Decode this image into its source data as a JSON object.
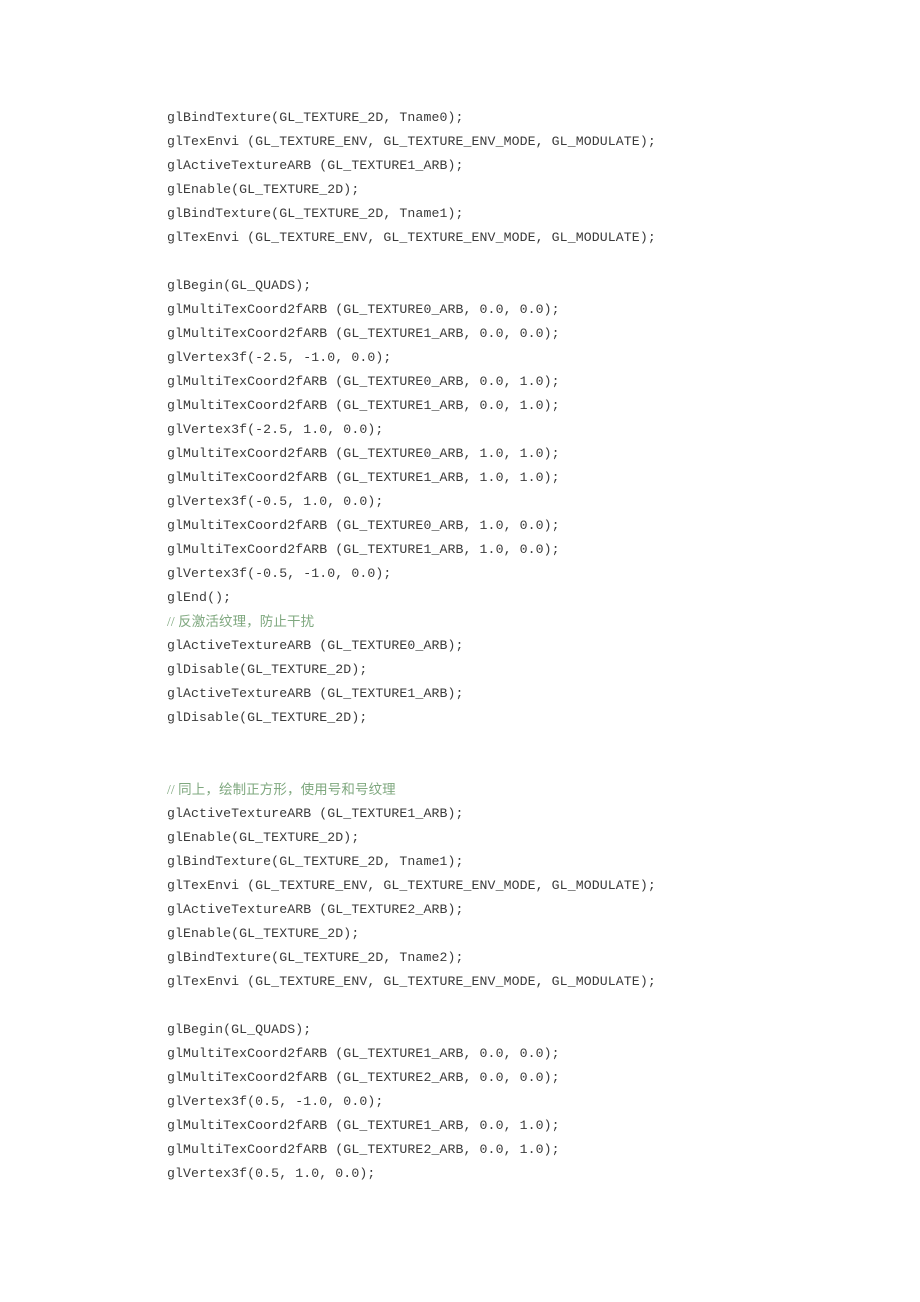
{
  "document": {
    "background_color": "#ffffff",
    "text_color": "#3a3a3a",
    "comment_color": "#7fa87f",
    "language": "C / OpenGL"
  },
  "code": {
    "lines": [
      {
        "text": "glBindTexture(GL_TEXTURE_2D, Tname0);",
        "kind": "code"
      },
      {
        "text": "glTexEnvi (GL_TEXTURE_ENV, GL_TEXTURE_ENV_MODE, GL_MODULATE);",
        "kind": "code"
      },
      {
        "text": "glActiveTextureARB (GL_TEXTURE1_ARB);",
        "kind": "code"
      },
      {
        "text": "glEnable(GL_TEXTURE_2D);",
        "kind": "code"
      },
      {
        "text": "glBindTexture(GL_TEXTURE_2D, Tname1);",
        "kind": "code"
      },
      {
        "text": "glTexEnvi (GL_TEXTURE_ENV, GL_TEXTURE_ENV_MODE, GL_MODULATE);",
        "kind": "code"
      },
      {
        "text": "",
        "kind": "blank"
      },
      {
        "text": "glBegin(GL_QUADS);",
        "kind": "code"
      },
      {
        "text": "glMultiTexCoord2fARB (GL_TEXTURE0_ARB, 0.0, 0.0);",
        "kind": "code"
      },
      {
        "text": "glMultiTexCoord2fARB (GL_TEXTURE1_ARB, 0.0, 0.0);",
        "kind": "code"
      },
      {
        "text": "glVertex3f(-2.5, -1.0, 0.0);",
        "kind": "code"
      },
      {
        "text": "glMultiTexCoord2fARB (GL_TEXTURE0_ARB, 0.0, 1.0);",
        "kind": "code"
      },
      {
        "text": "glMultiTexCoord2fARB (GL_TEXTURE1_ARB, 0.0, 1.0);",
        "kind": "code"
      },
      {
        "text": "glVertex3f(-2.5, 1.0, 0.0);",
        "kind": "code"
      },
      {
        "text": "glMultiTexCoord2fARB (GL_TEXTURE0_ARB, 1.0, 1.0);",
        "kind": "code"
      },
      {
        "text": "glMultiTexCoord2fARB (GL_TEXTURE1_ARB, 1.0, 1.0);",
        "kind": "code"
      },
      {
        "text": "glVertex3f(-0.5, 1.0, 0.0);",
        "kind": "code"
      },
      {
        "text": "glMultiTexCoord2fARB (GL_TEXTURE0_ARB, 1.0, 0.0);",
        "kind": "code"
      },
      {
        "text": "glMultiTexCoord2fARB (GL_TEXTURE1_ARB, 1.0, 0.0);",
        "kind": "code"
      },
      {
        "text": "glVertex3f(-0.5, -1.0, 0.0);",
        "kind": "code"
      },
      {
        "text": "glEnd();",
        "kind": "code"
      },
      {
        "text": "// 反激活纹理，防止干扰",
        "kind": "comment"
      },
      {
        "text": "glActiveTextureARB (GL_TEXTURE0_ARB);",
        "kind": "code"
      },
      {
        "text": "glDisable(GL_TEXTURE_2D);",
        "kind": "code"
      },
      {
        "text": "glActiveTextureARB (GL_TEXTURE1_ARB);",
        "kind": "code"
      },
      {
        "text": "glDisable(GL_TEXTURE_2D);",
        "kind": "code"
      },
      {
        "text": "",
        "kind": "blank"
      },
      {
        "text": "",
        "kind": "blank"
      },
      {
        "text": "// 同上，绘制正方形，使用号和号纹理",
        "kind": "comment"
      },
      {
        "text": "glActiveTextureARB (GL_TEXTURE1_ARB);",
        "kind": "code"
      },
      {
        "text": "glEnable(GL_TEXTURE_2D);",
        "kind": "code"
      },
      {
        "text": "glBindTexture(GL_TEXTURE_2D, Tname1);",
        "kind": "code"
      },
      {
        "text": "glTexEnvi (GL_TEXTURE_ENV, GL_TEXTURE_ENV_MODE, GL_MODULATE);",
        "kind": "code"
      },
      {
        "text": "glActiveTextureARB (GL_TEXTURE2_ARB);",
        "kind": "code"
      },
      {
        "text": "glEnable(GL_TEXTURE_2D);",
        "kind": "code"
      },
      {
        "text": "glBindTexture(GL_TEXTURE_2D, Tname2);",
        "kind": "code"
      },
      {
        "text": "glTexEnvi (GL_TEXTURE_ENV, GL_TEXTURE_ENV_MODE, GL_MODULATE);",
        "kind": "code"
      },
      {
        "text": "",
        "kind": "blank"
      },
      {
        "text": "glBegin(GL_QUADS);",
        "kind": "code"
      },
      {
        "text": "glMultiTexCoord2fARB (GL_TEXTURE1_ARB, 0.0, 0.0);",
        "kind": "code"
      },
      {
        "text": "glMultiTexCoord2fARB (GL_TEXTURE2_ARB, 0.0, 0.0);",
        "kind": "code"
      },
      {
        "text": "glVertex3f(0.5, -1.0, 0.0);",
        "kind": "code"
      },
      {
        "text": "glMultiTexCoord2fARB (GL_TEXTURE1_ARB, 0.0, 1.0);",
        "kind": "code"
      },
      {
        "text": "glMultiTexCoord2fARB (GL_TEXTURE2_ARB, 0.0, 1.0);",
        "kind": "code"
      },
      {
        "text": "glVertex3f(0.5, 1.0, 0.0);",
        "kind": "code"
      }
    ]
  }
}
